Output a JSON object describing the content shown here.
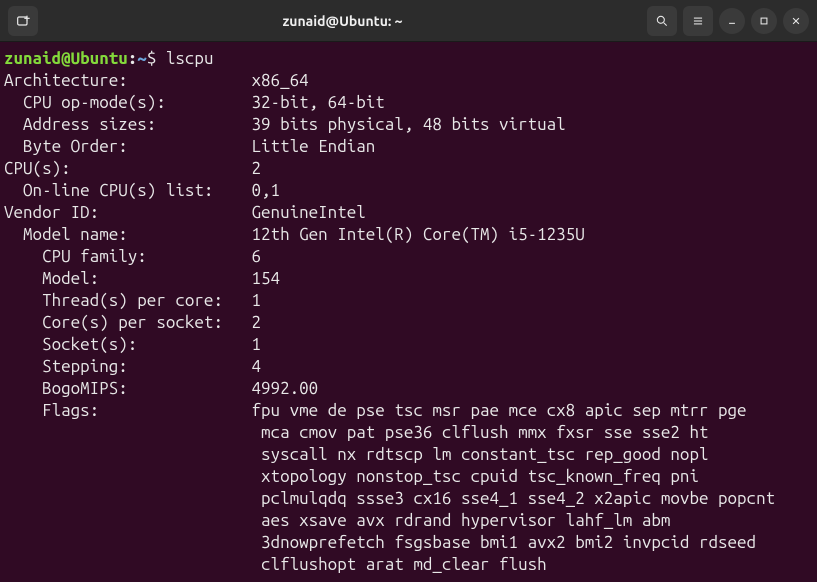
{
  "titlebar": {
    "title": "zunaid@Ubuntu: ~"
  },
  "prompt": {
    "user_host": "zunaid@Ubuntu",
    "colon": ":",
    "path": "~",
    "dollar": "$ "
  },
  "command": "lscpu",
  "output": {
    "rows": [
      {
        "indent": 0,
        "label": "Architecture:",
        "value": "x86_64"
      },
      {
        "indent": 1,
        "label": "CPU op-mode(s):",
        "value": "32-bit, 64-bit"
      },
      {
        "indent": 1,
        "label": "Address sizes:",
        "value": "39 bits physical, 48 bits virtual"
      },
      {
        "indent": 1,
        "label": "Byte Order:",
        "value": "Little Endian"
      },
      {
        "indent": 0,
        "label": "CPU(s):",
        "value": "2"
      },
      {
        "indent": 1,
        "label": "On-line CPU(s) list:",
        "value": "0,1"
      },
      {
        "indent": 0,
        "label": "Vendor ID:",
        "value": "GenuineIntel"
      },
      {
        "indent": 1,
        "label": "Model name:",
        "value": "12th Gen Intel(R) Core(TM) i5-1235U"
      },
      {
        "indent": 2,
        "label": "CPU family:",
        "value": "6"
      },
      {
        "indent": 2,
        "label": "Model:",
        "value": "154"
      },
      {
        "indent": 2,
        "label": "Thread(s) per core:",
        "value": "1"
      },
      {
        "indent": 2,
        "label": "Core(s) per socket:",
        "value": "2"
      },
      {
        "indent": 2,
        "label": "Socket(s):",
        "value": "1"
      },
      {
        "indent": 2,
        "label": "Stepping:",
        "value": "4"
      },
      {
        "indent": 2,
        "label": "BogoMIPS:",
        "value": "4992.00"
      },
      {
        "indent": 2,
        "label": "Flags:",
        "value": "fpu vme de pse tsc msr pae mce cx8 apic sep mtrr pge mca cmov pat pse36 clflush mmx fxsr sse sse2 ht syscall nx rdtscp lm constant_tsc rep_good nopl xtopology nonstop_tsc cpuid tsc_known_freq pni pclmulqdq ssse3 cx16 sse4_1 sse4_2 x2apic movbe popcnt aes xsave avx rdrand hypervisor lahf_lm abm 3dnowprefetch fsgsbase bmi1 avx2 bmi2 invpcid rdseed clflushopt arat md_clear flush"
      }
    ],
    "label_col": 26,
    "wrap_col": 80
  }
}
